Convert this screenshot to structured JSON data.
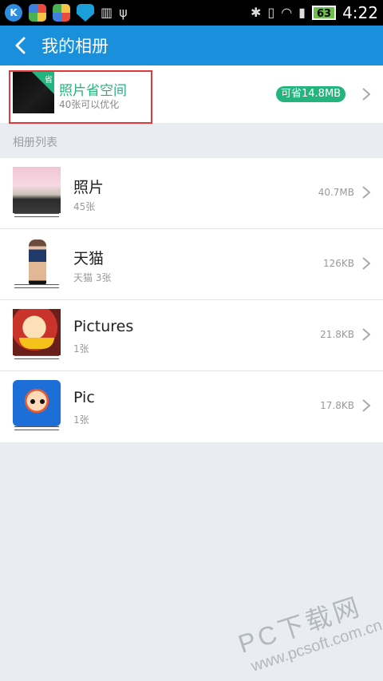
{
  "status_bar": {
    "apps": [
      "K"
    ],
    "battery": "63",
    "time": "4:22"
  },
  "header": {
    "title": "我的相册"
  },
  "optimize": {
    "badge_corner": "省",
    "title": "照片省空间",
    "subtitle": "40张可以优化",
    "save_badge": "可省14.8MB"
  },
  "section_label": "相册列表",
  "albums": [
    {
      "name": "照片",
      "count": "45张",
      "size": "40.7MB"
    },
    {
      "name": "天猫",
      "count": "天猫  3张",
      "size": "126KB"
    },
    {
      "name": "Pictures",
      "count": "1张",
      "size": "21.8KB"
    },
    {
      "name": "Pic",
      "count": "1张",
      "size": "17.8KB"
    }
  ],
  "watermark": {
    "line1": "PC下载网",
    "line2": "www.pcsoft.com.cn"
  },
  "colors": {
    "titlebar": "#1a8fdc",
    "accent_green": "#24b47e",
    "highlight_red": "#e23a3a"
  }
}
